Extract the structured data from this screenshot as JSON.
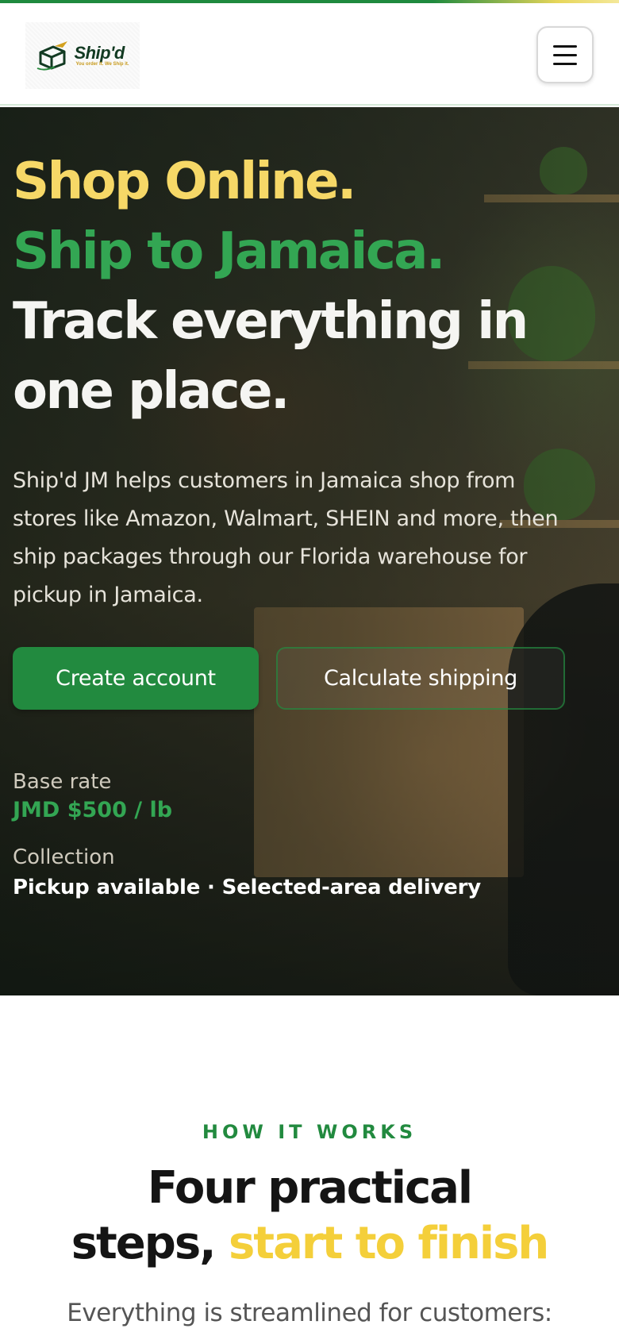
{
  "colors": {
    "brand_green": "#228a3f",
    "headline_yellow": "#f6d867",
    "headline_green": "#33a653",
    "accent_yellow": "#f4cf3a"
  },
  "header": {
    "logo": {
      "word": "Ship'd",
      "tagline": "You order it. We Ship it."
    },
    "menu_icon": "hamburger-icon"
  },
  "hero": {
    "headline": {
      "line1": "Shop Online.",
      "line2": "Ship to Jamaica.",
      "line3": "Track everything in",
      "line4": "one place."
    },
    "description": "Ship'd JM helps customers in Jamaica shop from stores like Amazon, Walmart, SHEIN and more, then ship packages through our Florida warehouse for pickup in Jamaica.",
    "buttons": {
      "primary": "Create account",
      "secondary": "Calculate shipping"
    },
    "stats": [
      {
        "label": "Base rate",
        "value": "JMD $500 / lb"
      },
      {
        "label": "Collection",
        "value": "Pickup available · Selected-area delivery"
      }
    ]
  },
  "how_it_works": {
    "eyebrow": "HOW IT WORKS",
    "title_line1": "Four practical",
    "title_line2_plain": "steps, ",
    "title_line2_accent": "start to finish",
    "subtitle": "Everything is streamlined for customers:"
  }
}
